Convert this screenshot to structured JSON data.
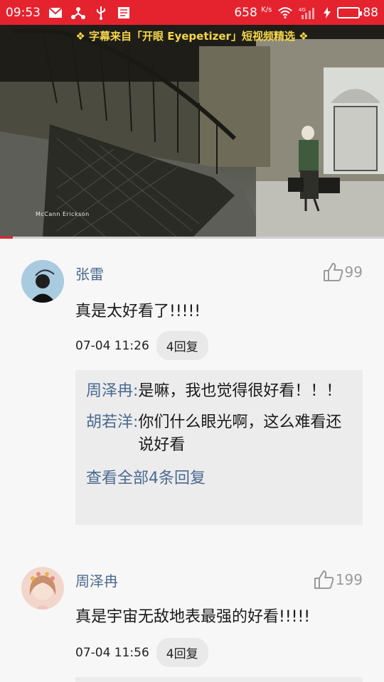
{
  "status_bar": {
    "time": "09:53",
    "net_speed": "658",
    "net_unit": "K/s",
    "battery": "88",
    "signal_label": "4G",
    "icons": [
      "mail-icon",
      "share-icon",
      "usb-icon",
      "document-icon",
      "wifi-icon",
      "signal-icon",
      "charging-icon",
      "battery-icon"
    ]
  },
  "video": {
    "banner": "❖ 字幕来自「开眼 Eyepetizer」短视频精选 ❖",
    "watermark": "McCann Erickson",
    "progress": 0.033
  },
  "comments": [
    {
      "user": "张雷",
      "likes": "99",
      "text": "真是太好看了!!!!!",
      "time": "07-04 11:26",
      "reply_count": "4回复",
      "replies": [
        {
          "name": "周泽冉:",
          "text": "是嘛，我也觉得很好看！！！"
        },
        {
          "name": "胡若洋:",
          "text": "你们什么眼光啊，这么难看还说好看"
        }
      ],
      "see_all": "查看全部4条回复"
    },
    {
      "user": "周泽冉",
      "likes": "199",
      "text": "真是宇宙无敌地表最强的好看!!!!!",
      "time": "07-04 11:56",
      "reply_count": "4回复"
    }
  ],
  "colors": {
    "status_bar": "#e5232f",
    "username": "#4a6a8f",
    "banner": "#f5d64a"
  }
}
